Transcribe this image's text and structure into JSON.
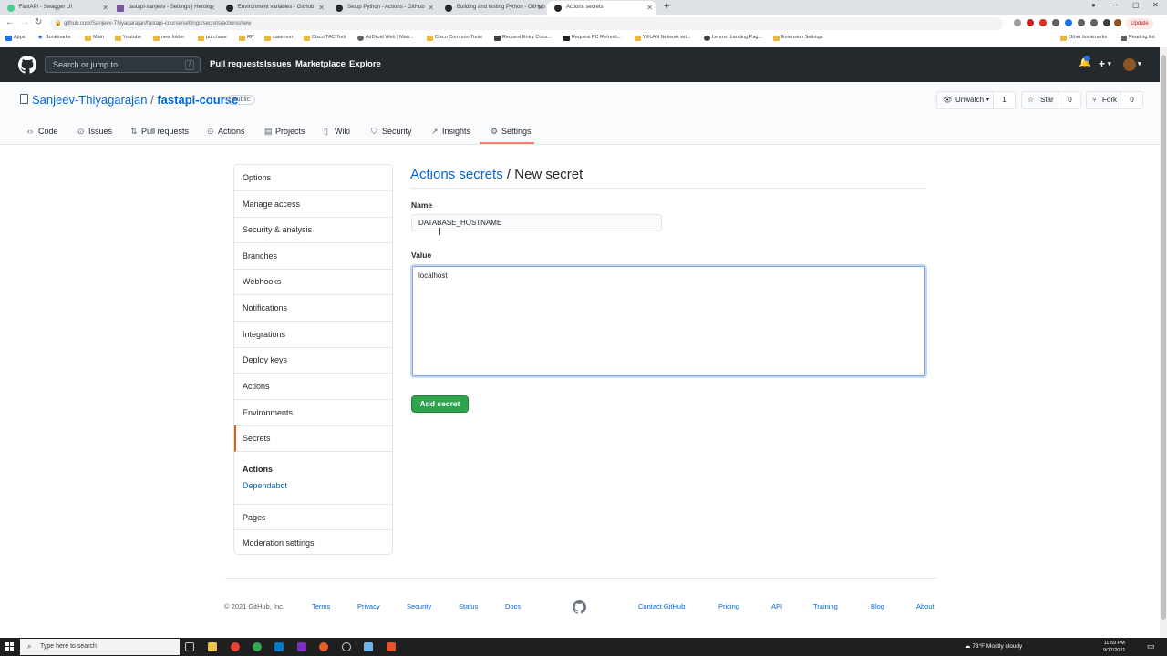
{
  "browser": {
    "tabs": [
      {
        "title": "FastAPI - Swagger UI",
        "color": "#49cc90"
      },
      {
        "title": "fastapi-sanjeev - Settings | Heroku",
        "color": "#79589f"
      },
      {
        "title": "Environment variables - GitHub",
        "color": "#24292e"
      },
      {
        "title": "Setup Python - Actions - GitHub",
        "color": "#24292e"
      },
      {
        "title": "Building and testing Python - GitHub",
        "color": "#24292e"
      },
      {
        "title": "Actions secrets",
        "color": "#24292e"
      }
    ],
    "url": "github.com/Sanjeev-Thiyagarajan/fastapi-course/settings/secrets/actions/new",
    "update_label": "Update",
    "bookmarks": [
      "Apps",
      "Bookmarks",
      "Main",
      "Youtube",
      "new folder",
      "purchase",
      "RP",
      "casemon",
      "Cisco TAC Tool",
      "AirDroid Web | Man...",
      "Cisco Common Tools",
      "Request Entry Cons...",
      "Request PC Refresh...",
      "VXLAN Network wit...",
      "Lenovo Landing Pag...",
      "Extension Settings",
      "Other bookmarks",
      "Reading list"
    ]
  },
  "github_header": {
    "search_placeholder": "Search or jump to...",
    "search_shortcut": "/",
    "nav": [
      "Pull requests",
      "Issues",
      "Marketplace",
      "Explore"
    ],
    "plus": "+",
    "caret": "▾"
  },
  "repo": {
    "owner": "Sanjeev-Thiyagarajan",
    "separator": "/",
    "name": "fastapi-course",
    "visibility": "Public",
    "unwatch_label": "Unwatch",
    "unwatch_count": "1",
    "star_label": "Star",
    "star_count": "0",
    "fork_label": "Fork",
    "fork_count": "0",
    "tabs": [
      "Code",
      "Issues",
      "Pull requests",
      "Actions",
      "Projects",
      "Wiki",
      "Security",
      "Insights",
      "Settings"
    ]
  },
  "sidebar": {
    "items": [
      "Options",
      "Manage access",
      "Security & analysis",
      "Branches",
      "Webhooks",
      "Notifications",
      "Integrations",
      "Deploy keys",
      "Actions",
      "Environments",
      "Secrets"
    ],
    "sub_items": [
      "Actions",
      "Dependabot"
    ],
    "bottom_items": [
      "Pages",
      "Moderation settings"
    ]
  },
  "form": {
    "breadcrumb_link": "Actions secrets",
    "breadcrumb_sep": "/",
    "title": "New secret",
    "name_label": "Name",
    "name_value": "DATABASE_HOSTNAME",
    "value_label": "Value",
    "value_text": "localhost",
    "submit_label": "Add secret"
  },
  "footer": {
    "copyright": "© 2021 GitHub, Inc.",
    "links_left": [
      "Terms",
      "Privacy",
      "Security",
      "Status",
      "Docs"
    ],
    "links_right": [
      "Contact GitHub",
      "Pricing",
      "API",
      "Training",
      "Blog",
      "About"
    ]
  },
  "taskbar": {
    "search_placeholder": "Type here to search",
    "weather": "73°F  Mostly cloudy",
    "time": "11:59 PM",
    "date": "9/17/2021"
  }
}
